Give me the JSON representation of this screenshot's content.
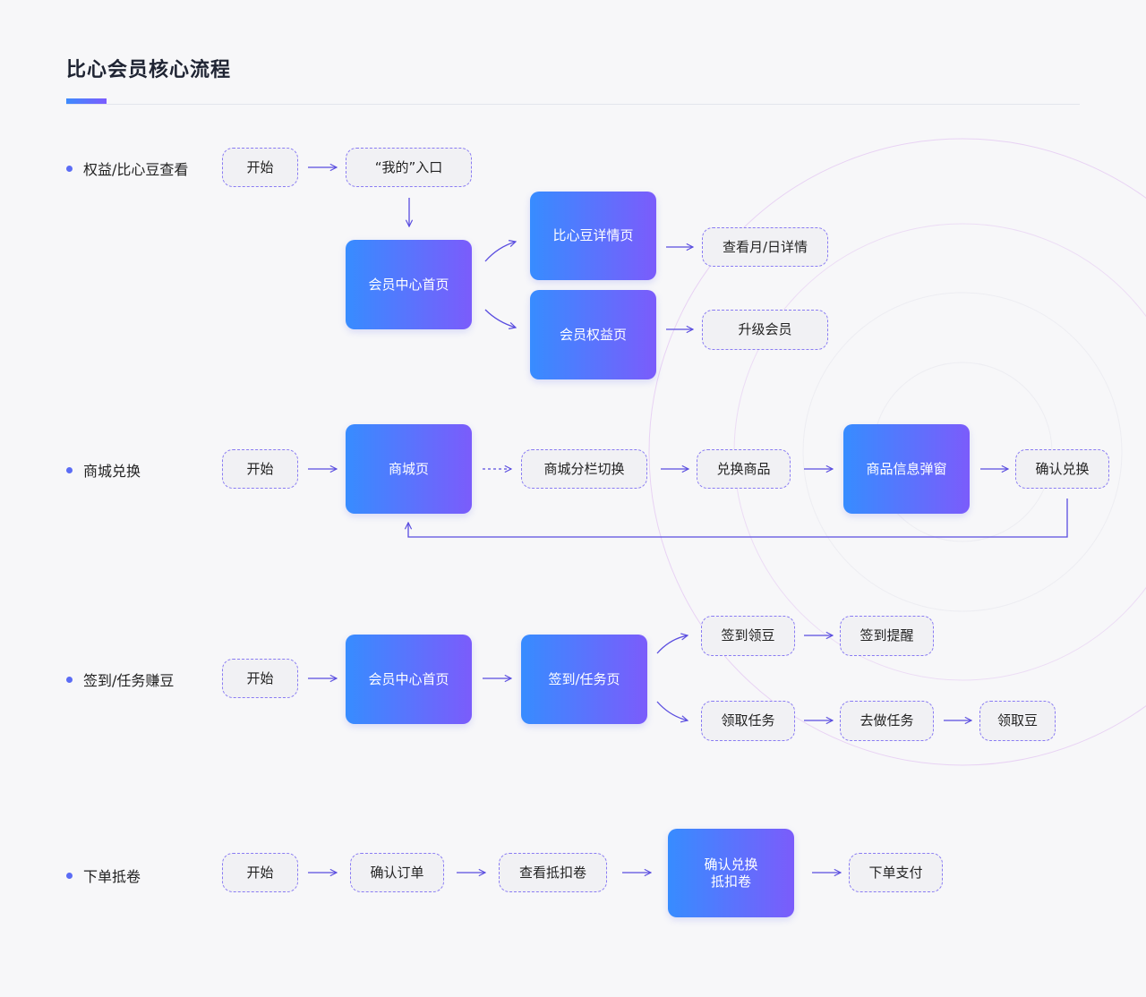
{
  "title": "比心会员核心流程",
  "rows": [
    {
      "label": "权益/比心豆查看"
    },
    {
      "label": "商城兑换"
    },
    {
      "label": "签到/任务赚豆"
    },
    {
      "label": "下单抵卷"
    }
  ],
  "nodes": {
    "r1_start": "开始",
    "r1_entry": "“我的”入口",
    "r1_home": "会员中心首页",
    "r1_bean_detail": "比心豆详情页",
    "r1_rights": "会员权益页",
    "r1_month_day": "查看月/日详情",
    "r1_upgrade": "升级会员",
    "r2_start": "开始",
    "r2_mall": "商城页",
    "r2_tab_switch": "商城分栏切换",
    "r2_exchange_goods": "兑换商品",
    "r2_goods_popup": "商品信息弹窗",
    "r2_confirm": "确认兑换",
    "r3_start": "开始",
    "r3_home": "会员中心首页",
    "r3_sign_task": "签到/任务页",
    "r3_sign_bean": "签到领豆",
    "r3_sign_remind": "签到提醒",
    "r3_get_task": "领取任务",
    "r3_do_task": "去做任务",
    "r3_get_bean": "领取豆",
    "r4_start": "开始",
    "r4_confirm_order": "确认订单",
    "r4_view_coupon": "查看抵扣卷",
    "r4_confirm_coupon": "确认兑换\n抵扣卷",
    "r4_pay": "下单支付"
  },
  "colors": {
    "accent_start": "#378cff",
    "accent_end": "#7b5cfb",
    "arrow": "#5a4de0",
    "dashed_border": "#8a7cf3"
  }
}
